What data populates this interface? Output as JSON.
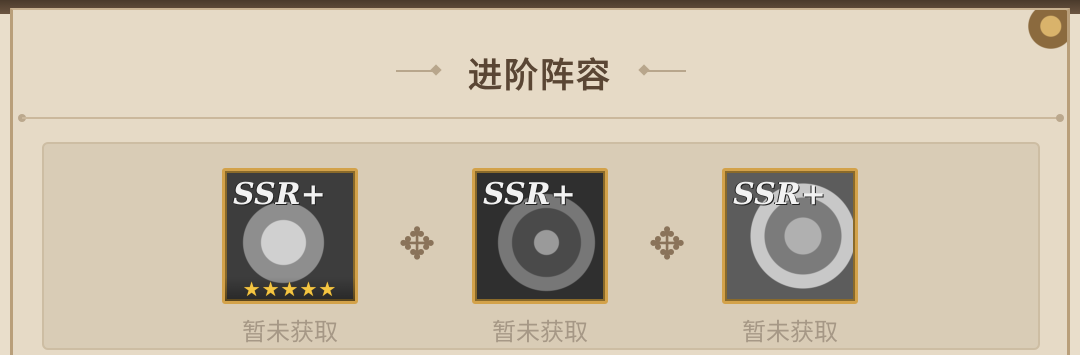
{
  "panel": {
    "title": "进阶阵容"
  },
  "lineup": {
    "heroes": [
      {
        "rarity": "SSR+",
        "stars": "★★★★★",
        "status": "暂未获取"
      },
      {
        "rarity": "SSR+",
        "stars": "",
        "status": "暂未获取"
      },
      {
        "rarity": "SSR+",
        "stars": "",
        "status": "暂未获取"
      }
    ],
    "separator_icon": "plus-arrows-icon"
  },
  "colors": {
    "title": "#5a4634",
    "panel_bg": "#e6dac6",
    "portrait_border": "#d3a24a",
    "status_text": "#a69886",
    "star": "#f4c542"
  }
}
